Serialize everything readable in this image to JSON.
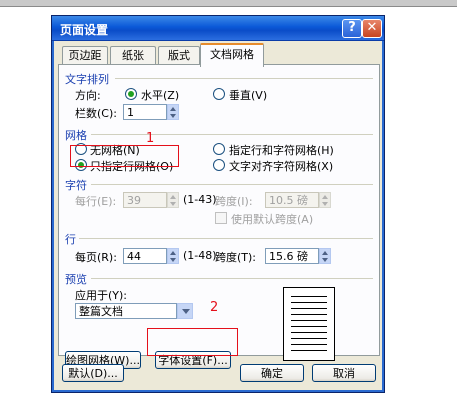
{
  "window": {
    "title": "页面设置",
    "help_glyph": "?",
    "close_glyph": "✕"
  },
  "tabs": [
    "页边距",
    "纸张",
    "版式",
    "文档网格"
  ],
  "text_direction": {
    "section": "文字排列",
    "direction_label": "方向:",
    "horizontal": "水平(Z)",
    "vertical": "垂直(V)",
    "columns_label": "栏数(C):",
    "columns_value": "1"
  },
  "grid": {
    "section": "网格",
    "no_grid": "无网格(N)",
    "specify_line_and_char": "指定行和字符网格(H)",
    "specify_line_only": "只指定行网格(O)",
    "align_to_char": "文字对齐字符网格(X)",
    "selected": "specify_line_only"
  },
  "chars": {
    "section": "字符",
    "per_line_label": "每行(E):",
    "per_line_value": "39",
    "per_line_range": "(1-43)",
    "pitch_label": "跨度(I):",
    "pitch_value": "10.5 磅",
    "default_pitch_label": "使用默认跨度(A)"
  },
  "lines": {
    "section": "行",
    "per_page_label": "每页(R):",
    "per_page_value": "44",
    "per_page_range": "(1-48)",
    "pitch_label": "跨度(T):",
    "pitch_value": "15.6 磅"
  },
  "preview": {
    "section": "预览",
    "apply_to_label": "应用于(Y):",
    "apply_to_value": "整篇文档"
  },
  "buttons": {
    "drawing_grid": "绘图网格(W)...",
    "font_settings": "字体设置(F)...",
    "default": "默认(D)...",
    "ok": "确定",
    "cancel": "取消"
  },
  "annotations": {
    "marker_1": "1",
    "marker_2": "2"
  },
  "colors": {
    "annotation": "#e4101b",
    "section_heading": "#1a3fb0",
    "title_bar": "#0b59d8"
  }
}
